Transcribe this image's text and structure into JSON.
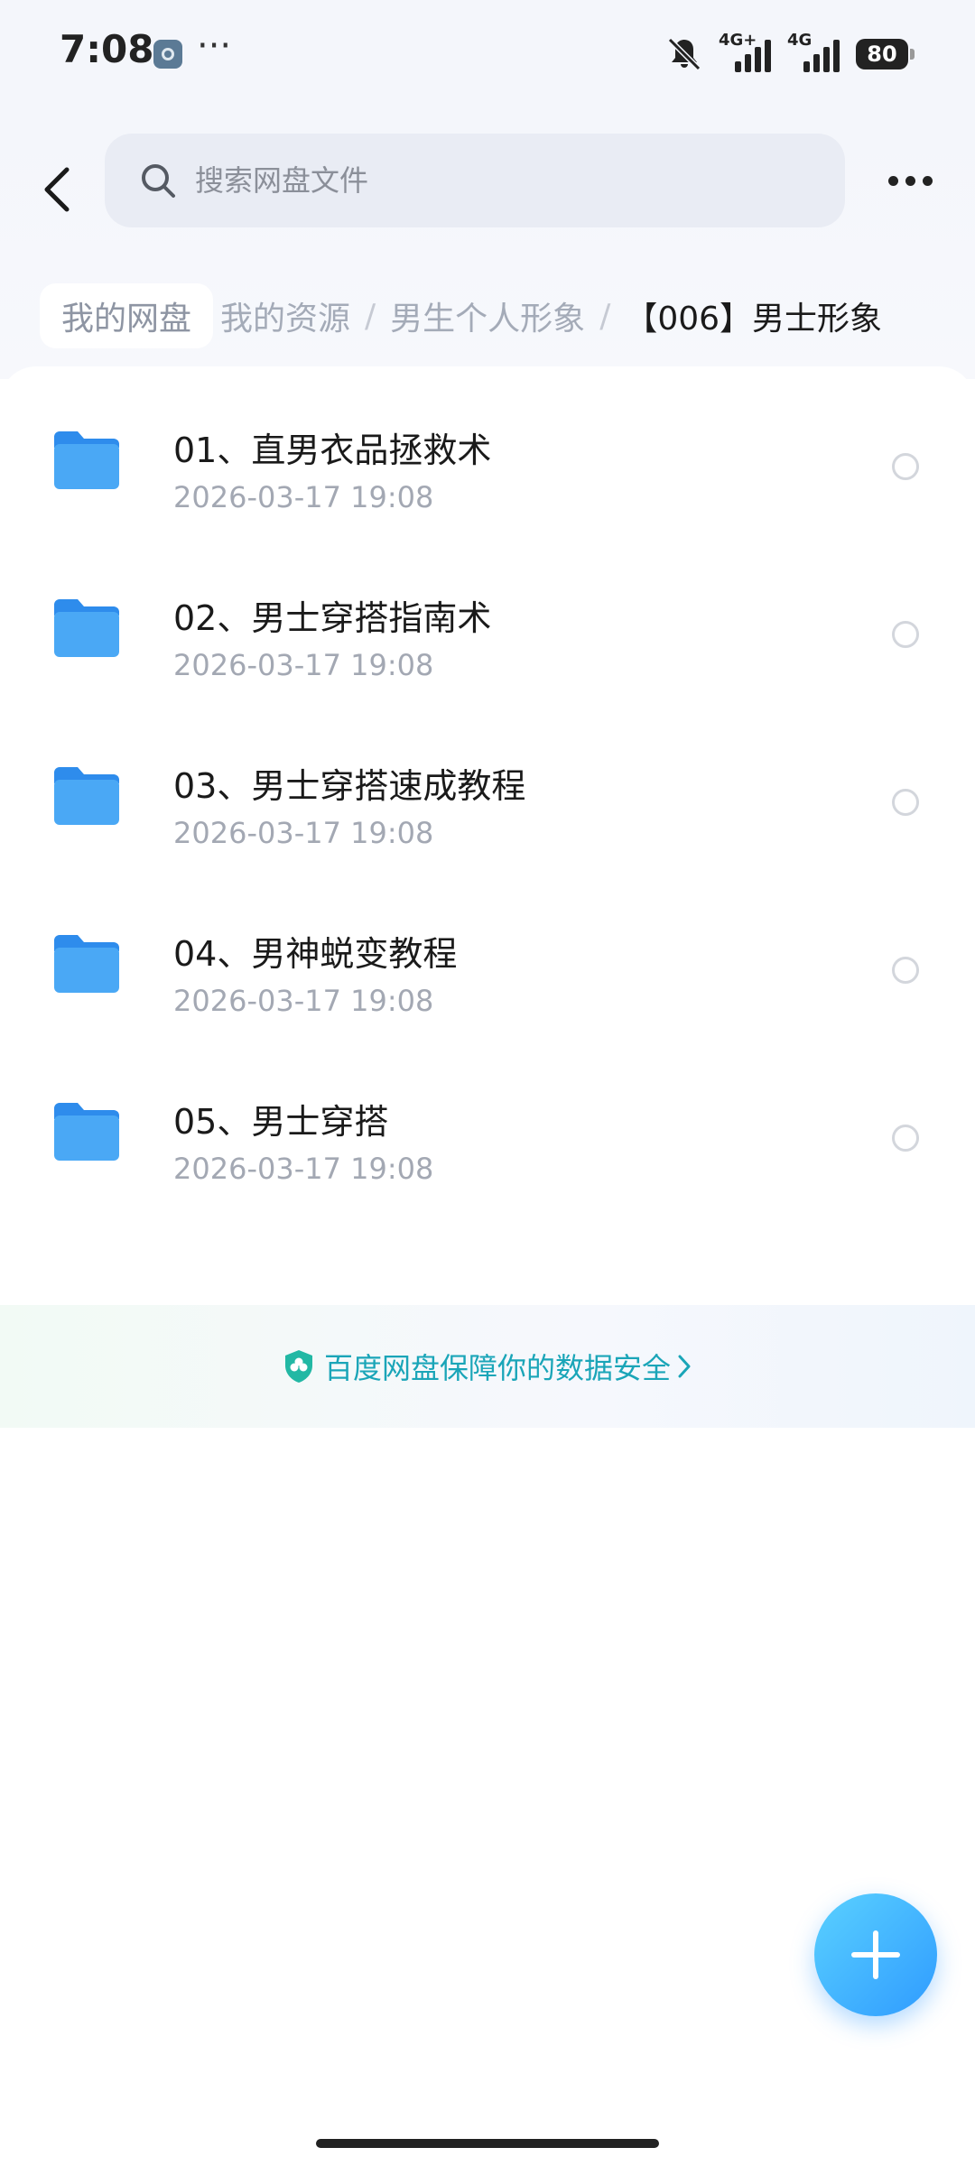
{
  "status_bar": {
    "time": "7:08",
    "more": "···",
    "network_1": "4G+",
    "network_2": "4G",
    "battery": "80"
  },
  "search": {
    "placeholder": "搜索网盘文件"
  },
  "breadcrumb": {
    "root": "我的网盘",
    "items": [
      "我的资源",
      "男生个人形象"
    ],
    "separator": "/",
    "current": "【006】男士形象"
  },
  "files": [
    {
      "name": "01、直男衣品拯救术",
      "date": "2026-03-17  19:08"
    },
    {
      "name": "02、男士穿搭指南术",
      "date": "2026-03-17  19:08"
    },
    {
      "name": "03、男士穿搭速成教程",
      "date": "2026-03-17  19:08"
    },
    {
      "name": "04、男神蜕变教程",
      "date": "2026-03-17  19:08"
    },
    {
      "name": "05、男士穿搭",
      "date": "2026-03-17  19:08"
    }
  ],
  "security_banner": {
    "text": "百度网盘保障你的数据安全"
  },
  "colors": {
    "accent": "#2f9bff",
    "folder": "#4aa8f5",
    "banner_text": "#1aa5b8"
  }
}
